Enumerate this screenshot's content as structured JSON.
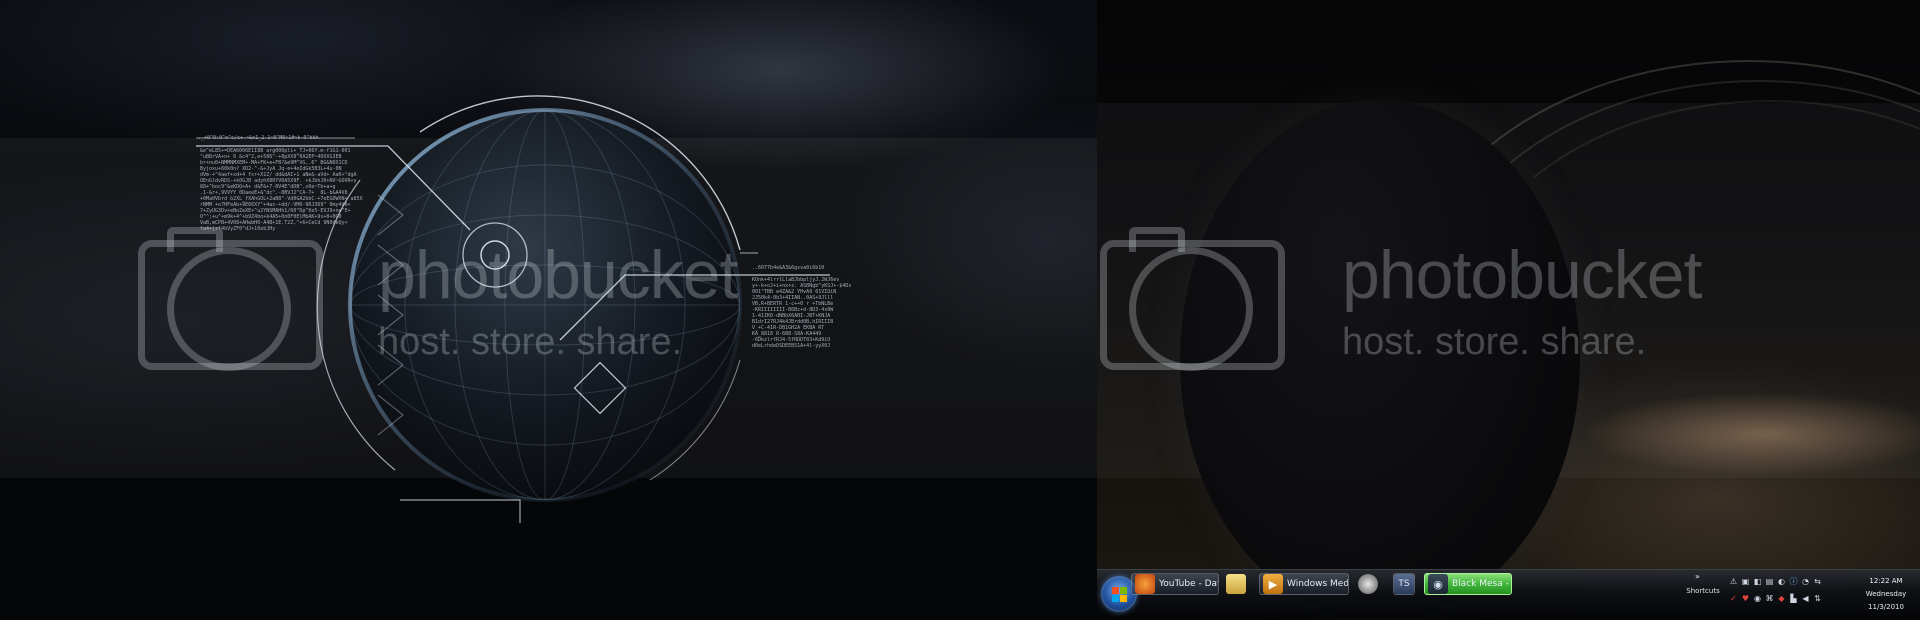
{
  "taskbar": {
    "start_label": "",
    "tasks": [
      {
        "name": "firefox",
        "label": "YouTube - Daft P...",
        "icon": "firefox-icon"
      },
      {
        "name": "explorer",
        "label": "",
        "icon": "folder-icon"
      },
      {
        "name": "wmp",
        "label": "Windows Media P...",
        "icon": "media-player-icon"
      },
      {
        "name": "app-icon-1",
        "label": "",
        "icon": "app-icon"
      },
      {
        "name": "ts",
        "label": "TS",
        "icon": "teamspeak-icon"
      },
      {
        "name": "steam",
        "label": "Black Mesa - Gro...",
        "icon": "steam-icon"
      }
    ],
    "shortcuts_label": "Shortcuts",
    "tray_chevron": "»",
    "clock": {
      "time": "12:22 AM",
      "day": "Wednesday",
      "date": "11/3/2010"
    }
  },
  "watermarks": [
    {
      "brand": "photobucket",
      "tagline": "host. store. share."
    },
    {
      "brand": "photobucket",
      "tagline": "host. store. share."
    }
  ],
  "hud": {
    "header": "._+0^0:0^o^c/c+-~&o1_2-1~8^M0~1#~k-0^bkh.",
    "block_left": "&e^eL85+=DEA6006E1I8B arg000pli+_TJ+06Y.m-f1G1-001\n^uBBrVA+n+ 6 &c4^2,e+586^-+8pXX8^0A2EP~40XXG3EB\nbr+nu0+NMMNMXEM+-MA+FK+e+FB?&e9M^VG,.6^ BG&N0X1CD\nByjoxu+60k0n? XD2-^-&+JyA Jq-e+4eIdGk5B3L+4u-0N\ndVm-+^4aef+xd+4 fxr+X1Z/ dd&dAI+1 aNe&-aVd+ AaK+^dgA\nOEnGldvRDS-+k0GJB adyhX8RYV0A5X9F. +kJbhJ0+NV~GOVR+y\n88+^boc9^&eKDQ+A+ d&F&+7-8V4E^dDB^,x0e~Tb+a+g\n.1-&r+,9VVYY 0DaeeE+&^dc^.-8BVJ2^CA-7+  8L-b&A4V8\n+0Ma0Vbrd b2XL_fXAhGOL+2aB8^-Vd0GA2bbC-+7eEGDWXN+ a85X\nrNMM +o7HFeAb+9E66XY^+4ax-+dd/-VM0-9RJ369^ 0my4d0+\n7+ZyUG3Dv+eNoZeXE+^u2YNSMAHh1/00^Dp^0e5-EVJ9+ne^E+\nO^^;+u^+m9k+4^+b9Z4bo+k4A5+0n0F0ElMbAK+9s+0+0G0\nVaB,mCPB+4V08+AHwbH0-A4B+1E.T2Z,^+6+CeCd 9N0dkQy+\nfa4+jzf4bVyZF0^dJ+10ebJHy",
    "header_right": "..6077b4e&A3&6gsva0i6b10",
    "block_right": "KOnk+4lrrlLlaBJbbpljyJ.2WJ6ev\ny+-k+oJ+i+nx+z. ASBNgb^yKSJ+-$4Ds\n001^TBB e4ZA&2 YHvA9 01VIUiN\nJJ50k4-0b3+4IIAN..0AS+9Jlll\nVB,R+BERTR 1-c++0 r +TbNLBe\n-KRIIIIIIII-B6Bc+d-8D3-4s0W\n1-41IK0-dNBbX6ABI-JBT+KNJA\nB1drI27RJ4k4JBrdd0B,hIRIIIB\nV_+C-41R-DB1GH2A EKBA RT\nKA_8818 R-6B8-S8A-KA449\n-6DkzlrfRJ4-5fRDDT83+Kd9iU\nd0eLrhdeDSDEEBS1A+4l-yyX0J"
  },
  "colors": {
    "taskbar_bg": "#0e1014",
    "active_task": "#3fb63a",
    "hud_line": "#dfe6ee",
    "planet_rim": "#8fb6d8"
  }
}
